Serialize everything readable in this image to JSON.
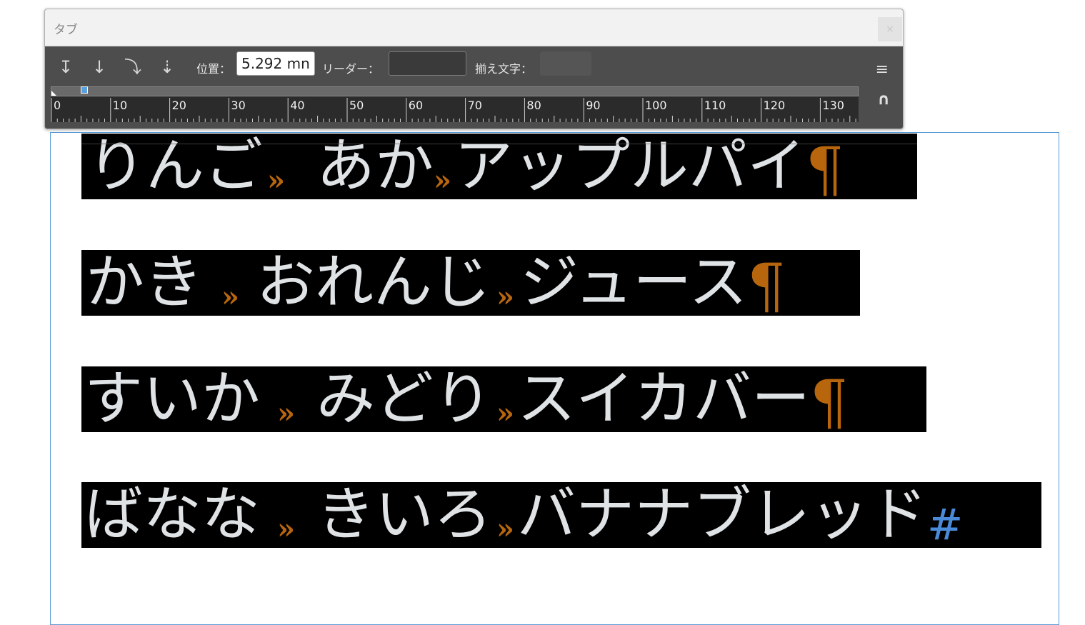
{
  "panel": {
    "title": "タブ",
    "close_glyph": "×",
    "tab_buttons": [
      {
        "name": "left-justified-tab",
        "glyph": "↧"
      },
      {
        "name": "center-justified-tab",
        "glyph": "↓"
      },
      {
        "name": "right-justified-tab",
        "glyph": "⤵"
      },
      {
        "name": "align-to-decimal-tab",
        "glyph": "⇣"
      }
    ],
    "position_label": "位置：",
    "position_value": "5.292 mn",
    "leader_label": "リーダー：",
    "leader_value": "",
    "align_on_label": "揃え文字：",
    "align_on_value": "",
    "menu_glyph": "≡",
    "magnet_glyph": "∩",
    "ruler_labels": [
      "0",
      "10",
      "20",
      "30",
      "40",
      "50",
      "60",
      "70",
      "80",
      "90",
      "100",
      "110",
      "120",
      "130"
    ]
  },
  "document": {
    "lines": [
      {
        "a": "りんご",
        "b": "あか",
        "c": "アップルパイ",
        "end": "¶"
      },
      {
        "a": "かき",
        "b": "おれんじ",
        "c": "ジュース",
        "end": "¶"
      },
      {
        "a": "すいか",
        "b": "みどり",
        "c": "スイカバー",
        "end": "¶"
      },
      {
        "a": "ばなな",
        "b": "きいろ",
        "c": "バナナブレッド",
        "end": "#"
      }
    ],
    "tab_glyph": "»"
  },
  "colors": {
    "highlight_bg": "#000000",
    "text": "#dfe3e6",
    "hidden_char": "#b8660e",
    "frame_border": "#5b9bd5",
    "end_of_story": "#4a8ad8"
  }
}
